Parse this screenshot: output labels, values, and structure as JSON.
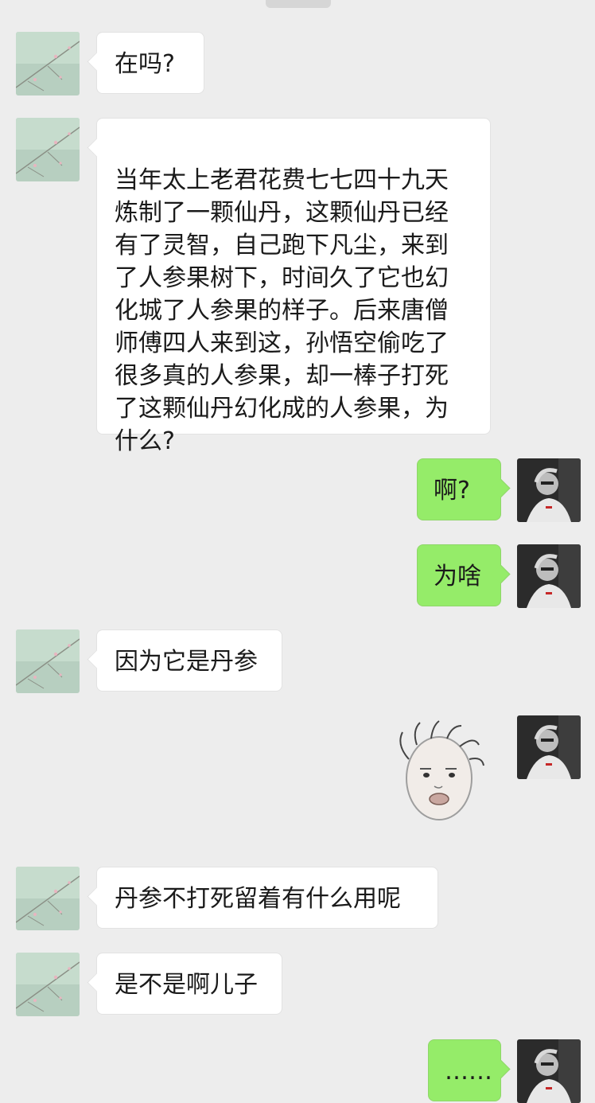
{
  "messages": [
    {
      "side": "left",
      "text": "在吗?"
    },
    {
      "side": "left",
      "text": "当年太上老君花费七七四十九天\n炼制了一颗仙丹，这颗仙丹已经\n有了灵智，自己跑下凡尘，来到\n了人参果树下，时间久了它也幻\n化城了人参果的样子。后来唐僧\n师傅四人来到这，孙悟空偷吃了\n很多真的人参果，却一棒子打死\n了这颗仙丹幻化成的人参果，为\n什么?"
    },
    {
      "side": "right",
      "text": "啊?"
    },
    {
      "side": "right",
      "text": "为啥"
    },
    {
      "side": "left",
      "text": "因为它是丹参"
    },
    {
      "side": "right",
      "type": "sticker",
      "icon": "face-sticker"
    },
    {
      "side": "left",
      "text": "丹参不打死留着有什么用呢"
    },
    {
      "side": "left",
      "text": "是不是啊儿子"
    },
    {
      "side": "right",
      "text": "……"
    }
  ],
  "avatars": {
    "left": "flower-branch-avatar",
    "right": "person-photo-avatar"
  },
  "colors": {
    "background": "#ededed",
    "incoming_bubble": "#ffffff",
    "outgoing_bubble": "#95ec69"
  }
}
